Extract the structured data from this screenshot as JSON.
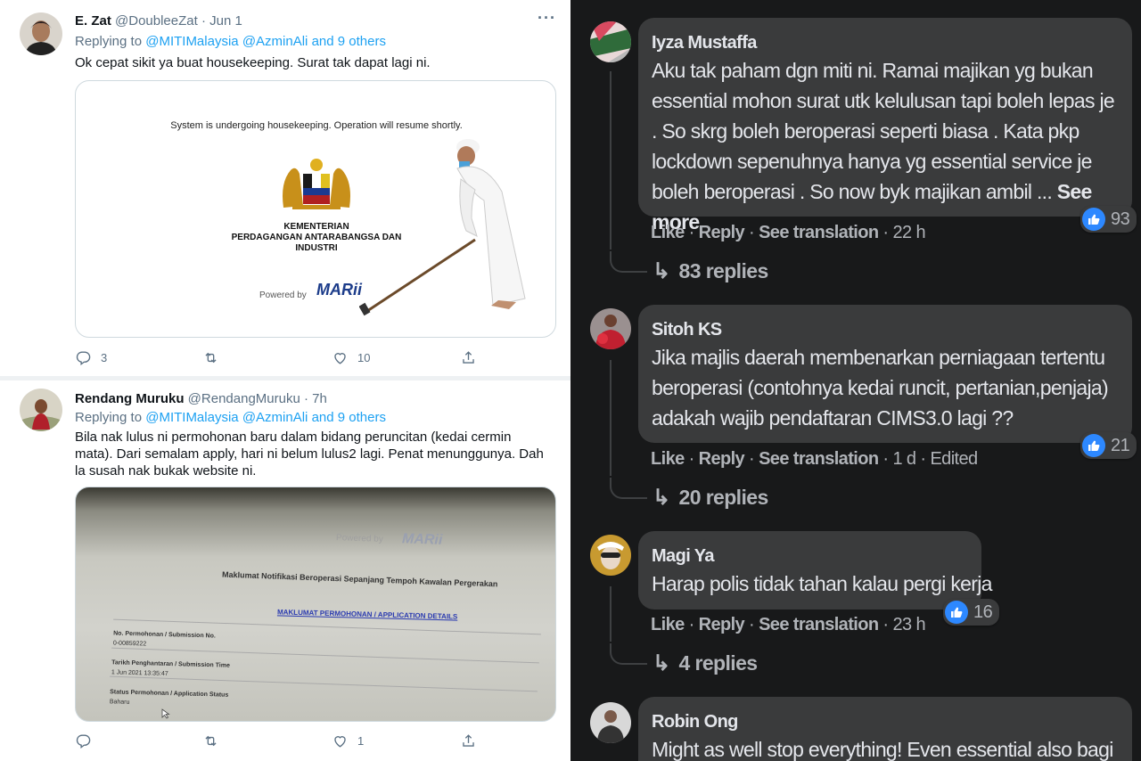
{
  "tweets": [
    {
      "name": "E. Zat",
      "handle": "@DoubleeZat",
      "time": "· Jun 1",
      "replying_prefix": "Replying to ",
      "mention1": "@MITIMalaysia",
      "mention2": "@AzminAli",
      "others": "and 9 others",
      "text": "Ok cepat sikit ya buat housekeeping. Surat tak dapat lagi ni.",
      "card": {
        "notice": "System is undergoing housekeeping. Operation will resume shortly.",
        "ministry_line1": "KEMENTERIAN",
        "ministry_line2": "PERDAGANGAN ANTARABANGSA DAN INDUSTRI",
        "powered_by": "Powered by",
        "brand": "MARii"
      },
      "replies": "3",
      "retweets": "",
      "likes": "10"
    },
    {
      "name": "Rendang Muruku",
      "handle": "@RendangMuruku",
      "time": "· 7h",
      "replying_prefix": "Replying to ",
      "mention1": "@MITIMalaysia",
      "mention2": "@AzminAli",
      "others": "and 9 others",
      "text": "Bila nak lulus ni permohonan baru dalam bidang peruncitan (kedai cermin mata). Dari semalam apply, hari ni belum lulus2 lagi. Penat menunggunya. Dah la susah nak bukak website ni.",
      "card": {
        "powered_by": "Powered by",
        "brand": "MARii",
        "form_title": "Maklumat Notifikasi Beroperasi Sepanjang Tempoh Kawalan Pergerakan",
        "section": "MAKLUMAT PERMOHONAN / APPLICATION DETAILS",
        "f1_label": "No. Permohonan / Submission No.",
        "f1_value": "0-00859222",
        "f2_label": "Tarikh Penghantaran / Submission Time",
        "f2_value": "1 Jun 2021 13:35:47",
        "f3_label": "Status Permohonan / Application Status",
        "f3_value": "Baharu"
      },
      "replies": "",
      "retweets": "",
      "likes": "1"
    }
  ],
  "comments": [
    {
      "name": "Iyza Mustaffa",
      "text": "Aku tak paham dgn miti ni. Ramai majikan yg bukan essential mohon surat utk kelulusan tapi boleh lepas je . So skrg boleh beroperasi seperti biasa . Kata pkp lockdown sepenuhnya hanya yg essential service je boleh beroperasi . So now byk majikan ambil ...",
      "see_more": "See more",
      "reactions": "93",
      "like": "Like",
      "reply": "Reply",
      "translate": "See translation",
      "time": "22 h",
      "edited": "",
      "replies": "83 replies"
    },
    {
      "name": "Sitoh KS",
      "text": "Jika majlis daerah membenarkan perniagaan tertentu beroperasi (contohnya kedai runcit, pertanian,penjaja) adakah wajib pendaftaran CIMS3.0 lagi ??",
      "reactions": "21",
      "like": "Like",
      "reply": "Reply",
      "translate": "See translation",
      "time": "1 d",
      "edited": "Edited",
      "replies": "20 replies"
    },
    {
      "name": "Magi Ya",
      "text": "Harap polis tidak tahan kalau pergi kerja",
      "reactions": "16",
      "like": "Like",
      "reply": "Reply",
      "translate": "See translation",
      "time": "23 h",
      "edited": "",
      "replies": "4 replies"
    },
    {
      "name": "Robin Ong",
      "text": "Might as well stop everything! Even essential also bagi"
    }
  ],
  "icons": {
    "reply": "reply-icon",
    "retweet": "retweet-icon",
    "like": "heart-icon",
    "share": "share-icon",
    "more": "more-icon",
    "fb_like": "thumbs-up-icon",
    "reply_arrow": "reply-arrow-icon"
  },
  "colors": {
    "twitter_blue": "#1da1f2",
    "fb_dark_bg": "#18191a",
    "fb_bubble": "#3a3b3c",
    "fb_blue": "#2d88ff"
  }
}
